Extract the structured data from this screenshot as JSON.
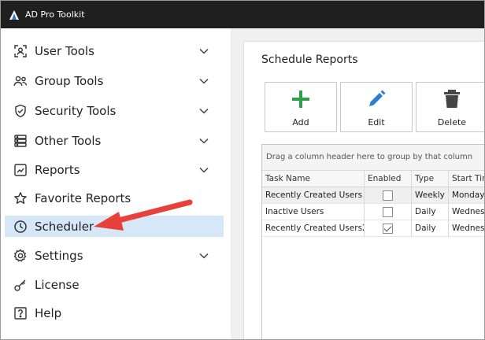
{
  "app": {
    "title": "AD Pro Toolkit"
  },
  "sidebar": {
    "items": [
      {
        "label": "User Tools",
        "icon": "user-icon",
        "expandable": true
      },
      {
        "label": "Group Tools",
        "icon": "group-icon",
        "expandable": true
      },
      {
        "label": "Security Tools",
        "icon": "shield-icon",
        "expandable": true
      },
      {
        "label": "Other Tools",
        "icon": "server-icon",
        "expandable": true
      },
      {
        "label": "Reports",
        "icon": "chart-icon",
        "expandable": true
      },
      {
        "label": "Favorite Reports",
        "icon": "star-icon",
        "expandable": false
      },
      {
        "label": "Scheduler",
        "icon": "clock-icon",
        "expandable": false,
        "selected": true
      },
      {
        "label": "Settings",
        "icon": "gear-icon",
        "expandable": true
      },
      {
        "label": "License",
        "icon": "key-icon",
        "expandable": false
      },
      {
        "label": "Help",
        "icon": "help-icon",
        "expandable": false
      }
    ]
  },
  "main": {
    "title": "Schedule Reports",
    "toolbar": {
      "add_label": "Add",
      "edit_label": "Edit",
      "delete_label": "Delete"
    },
    "grid": {
      "group_hint": "Drag a column header here to group by that column",
      "columns": [
        "Task Name",
        "Enabled",
        "Type",
        "Start Tim"
      ],
      "rows": [
        {
          "task_name": "Recently Created Users",
          "enabled": false,
          "type": "Weekly",
          "start_time": "Monday,"
        },
        {
          "task_name": "Inactive Users",
          "enabled": false,
          "type": "Daily",
          "start_time": "Wednesd"
        },
        {
          "task_name": "Recently Created Users2",
          "enabled": true,
          "type": "Daily",
          "start_time": "Wednesd"
        }
      ]
    }
  },
  "colors": {
    "titlebar": "#1f1f1f",
    "selected_bg": "#d6e8f7",
    "add_icon": "#2e9e4a",
    "edit_icon": "#2b7fd0",
    "delete_icon": "#444444",
    "annotation_arrow": "#e8403a"
  }
}
